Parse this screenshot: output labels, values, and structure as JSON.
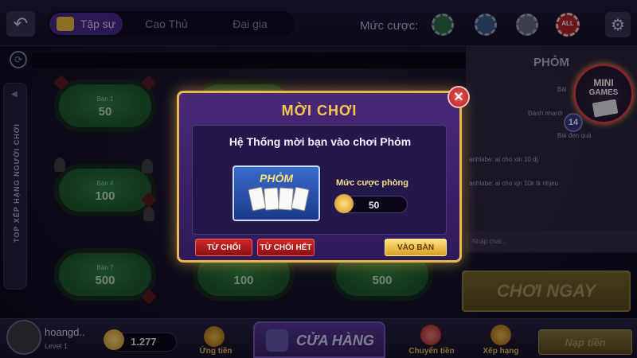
{
  "topbar": {
    "tabs": [
      {
        "label": "Tập sự",
        "active": true
      },
      {
        "label": "Cao Thủ",
        "active": false
      },
      {
        "label": "Đại gia",
        "active": false
      }
    ],
    "bet_label": "Mức cược:",
    "chips": [
      "chip-green",
      "chip-blue",
      "chip-gray",
      "chip-all"
    ],
    "chip_all_label": "ALL"
  },
  "sidebar": {
    "ranking_label": "TOP XẾP HẠNG NGƯỜI CHƠI"
  },
  "tables": [
    {
      "label": "Bàn 1",
      "bet": "50"
    },
    {
      "label": "Bàn 4",
      "bet": "100"
    },
    {
      "label": "Bàn 7",
      "bet": "500"
    },
    {
      "label": "",
      "bet": ""
    },
    {
      "label": "",
      "bet": ""
    },
    {
      "label": "",
      "bet": "100"
    },
    {
      "label": "",
      "bet": ""
    },
    {
      "label": "",
      "bet": ""
    },
    {
      "label": "",
      "bet": "500"
    }
  ],
  "chat": {
    "title": "PHỎM",
    "lines": [
      "Bài",
      "Đánh nhanh",
      "Bài đen quá",
      "anhlabe: ai cho xin 10 dj",
      "anhlabe: ai cho xjn 10k tk nhjeu"
    ],
    "input_placeholder": "Nhập chat..."
  },
  "play_now": "CHƠI NGAY",
  "mini_games": {
    "line1": "MINI",
    "line2": "GAMES",
    "count": "14"
  },
  "bottombar": {
    "username": "hoangd..",
    "level": "Level 1",
    "balance": "1.277",
    "support_label": "Ứng tiền",
    "shop_label": "CỬA HÀNG",
    "transfer_label": "Chuyển tiền",
    "ranking_label": "Xếp hạng",
    "topup_label": "Nạp tiền"
  },
  "modal": {
    "title": "MỜI CHƠI",
    "message": "Hệ Thống mời bạn vào chơi Phỏm",
    "game_name": "PHỎM",
    "room_bet_label": "Mức cược phòng",
    "room_bet_value": "50",
    "decline_label": "TỪ CHỐI",
    "decline_all_label": "TỪ CHỐI HẾT",
    "join_label": "VÀO BÀN"
  },
  "colors": {
    "accent_gold": "#f4c850",
    "modal_bg": "#4a2878",
    "decline_red": "#d02828",
    "table_green": "#2e7e46"
  }
}
